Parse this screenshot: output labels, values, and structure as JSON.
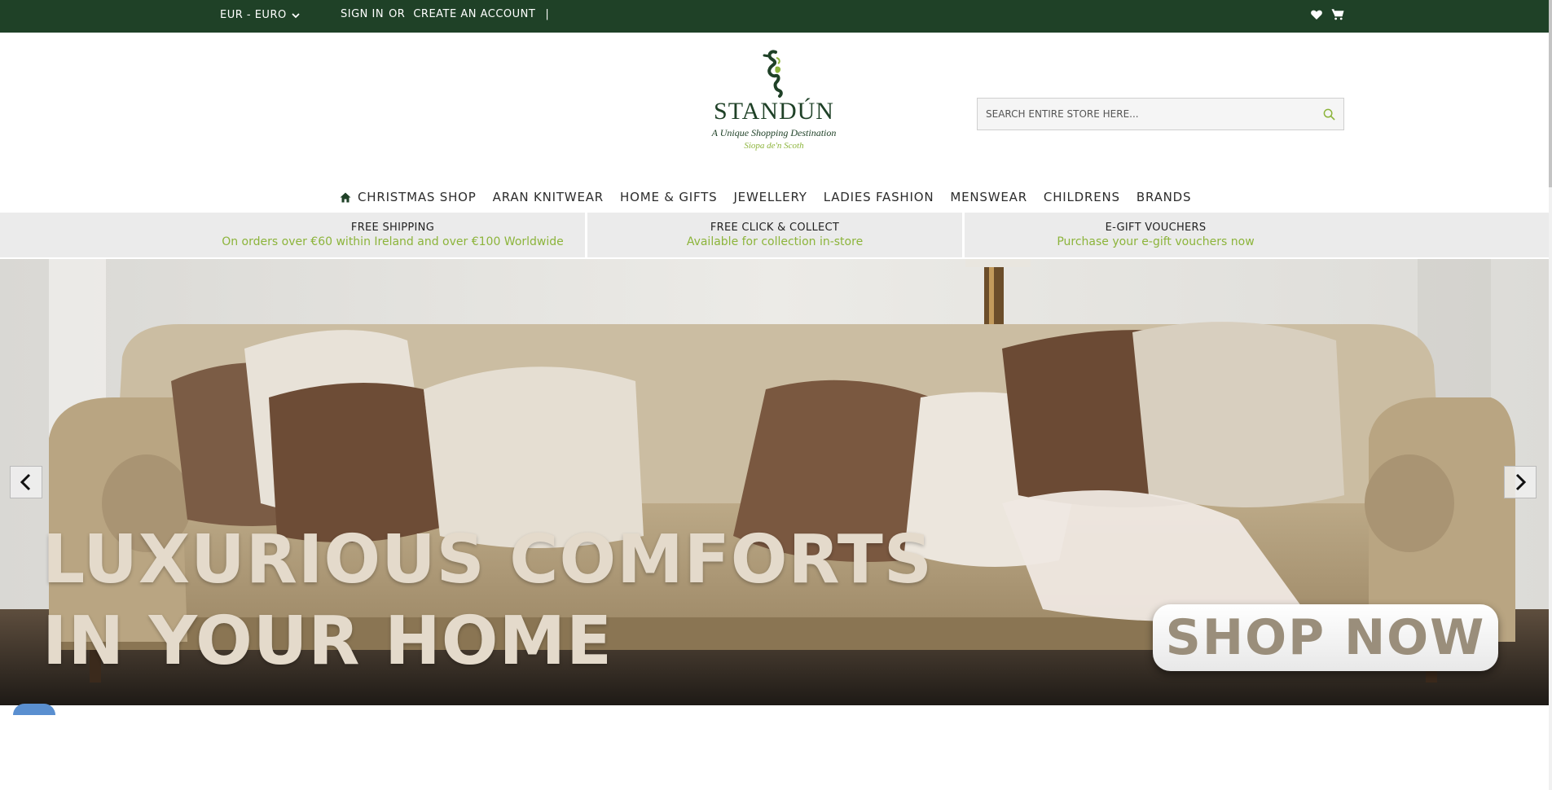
{
  "topbar": {
    "currency": "EUR - EURO",
    "sign_in": "SIGN IN",
    "or": "OR",
    "create_account": "CREATE AN ACCOUNT",
    "separator": "|",
    "icons": [
      "heart-icon",
      "cart-icon"
    ]
  },
  "logo": {
    "brand": "STANDÚN",
    "tagline": "A Unique Shopping Destination",
    "subtitle": "Siopa de'n Scoth"
  },
  "search": {
    "placeholder": "SEARCH ENTIRE STORE HERE..."
  },
  "nav": {
    "items": [
      {
        "label": "CHRISTMAS SHOP",
        "icon": "home-icon"
      },
      {
        "label": "ARAN KNITWEAR"
      },
      {
        "label": "HOME & GIFTS"
      },
      {
        "label": "JEWELLERY"
      },
      {
        "label": "LADIES FASHION"
      },
      {
        "label": "MENSWEAR"
      },
      {
        "label": "CHILDRENS"
      },
      {
        "label": "BRANDS"
      }
    ]
  },
  "usp": [
    {
      "title": "FREE SHIPPING",
      "text": "On orders over €60 within Ireland and over €100 Worldwide"
    },
    {
      "title": "FREE CLICK & COLLECT",
      "text": "Available for collection in-store"
    },
    {
      "title": "E-GIFT VOUCHERS",
      "text": "Purchase your e-gift vouchers now"
    }
  ],
  "hero": {
    "line1": "LUXURIOUS COMFORTS",
    "line2": "IN YOUR HOME",
    "cta": "SHOP NOW"
  },
  "colors": {
    "topbar": "#1f4127",
    "accent": "#8cb43b",
    "usp_bg": "#ebebeb"
  }
}
